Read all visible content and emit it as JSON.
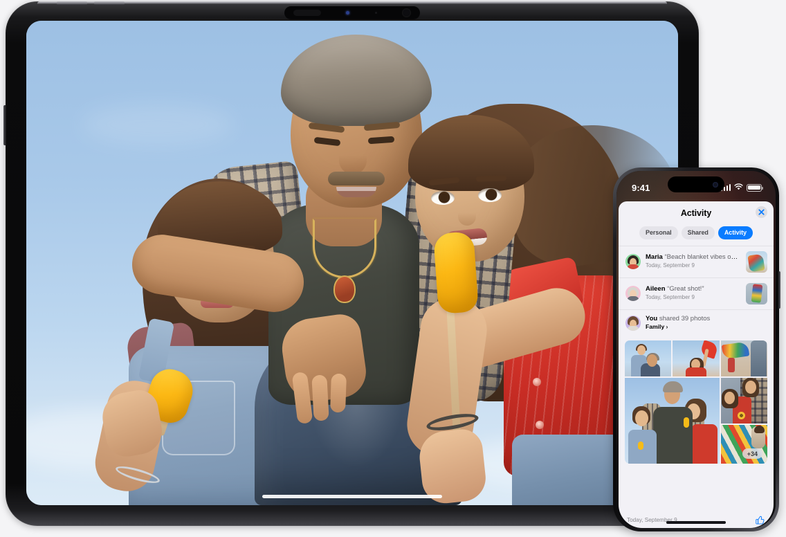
{
  "page": {
    "background_color": "#f4f4f6"
  },
  "ipad": {
    "device_name": "iPad Pro",
    "screen_content": "full-screen family beach photo",
    "photo": {
      "description": "A father kneeling on the beach with two daughters hugging him; both girls hold yellow popsicles under a blue sky",
      "subjects": [
        "father",
        "younger daughter",
        "older daughter"
      ]
    }
  },
  "iphone": {
    "device_name": "iPhone",
    "status_bar": {
      "time": "9:41",
      "cellular_icon": "cellular-bars-icon",
      "wifi_icon": "wifi-icon",
      "battery_icon": "battery-icon"
    },
    "sheet": {
      "title": "Activity",
      "close_icon": "close-icon",
      "segments": [
        {
          "label": "Personal",
          "active": false
        },
        {
          "label": "Shared",
          "active": false
        },
        {
          "label": "Activity",
          "active": true
        }
      ],
      "accent_color": "#0a7cff",
      "activity_rows": [
        {
          "name": "Maria",
          "message": "“Beach blanket vibes only”",
          "subtitle": "Today, September 9",
          "avatar_color": "#8bdc9f",
          "thumbnail": "beach-blanket-photo"
        },
        {
          "name": "Aileen",
          "message": "“Great shot!”",
          "subtitle": "Today, September 9",
          "avatar_color": "#f3c3d4",
          "thumbnail": "kite-photo"
        },
        {
          "name": "You",
          "message": "shared 39 photos",
          "subtitle": "Family",
          "subtitle_chevron": "chevron-right-icon",
          "avatar_color": "#c9b7e8"
        }
      ],
      "collage": {
        "photo_count_badge": "+34",
        "cells": [
          {
            "id": "a",
            "description": "Father giving daughter a piggyback ride"
          },
          {
            "id": "b",
            "description": "Girl holding a red kite"
          },
          {
            "id": "c",
            "description": "Colorful kites on the sand"
          },
          {
            "id": "d",
            "description": "Family portrait with popsicles"
          },
          {
            "id": "e",
            "description": "Two girls with a sunflower"
          },
          {
            "id": "f",
            "description": "Woman with a colorful beach blanket"
          }
        ]
      },
      "footer": {
        "date": "Today, September 9",
        "like_icon": "thumbs-up-icon"
      }
    }
  }
}
